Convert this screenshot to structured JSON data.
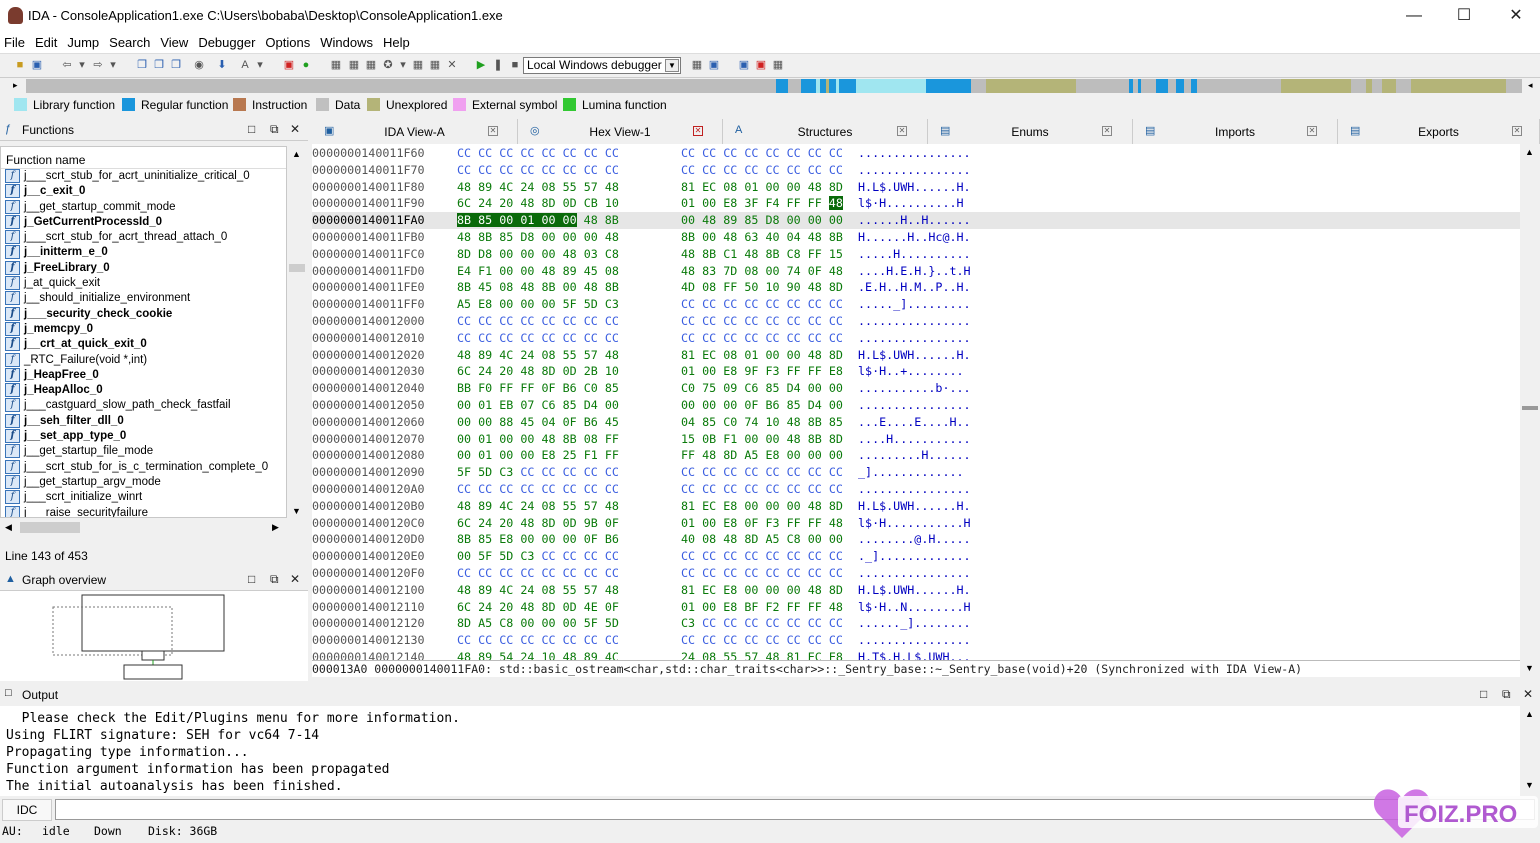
{
  "window": {
    "title": "IDA - ConsoleApplication1.exe C:\\Users\\bobaba\\Desktop\\ConsoleApplication1.exe"
  },
  "menu": [
    "File",
    "Edit",
    "Jump",
    "Search",
    "View",
    "Debugger",
    "Options",
    "Windows",
    "Help"
  ],
  "toolbar": {
    "debugger_select": "Local Windows debugger"
  },
  "legend": [
    {
      "label": "Library function",
      "color": "#a0e6f0"
    },
    {
      "label": "Regular function",
      "color": "#1a96dc"
    },
    {
      "label": "Instruction",
      "color": "#b87850"
    },
    {
      "label": "Data",
      "color": "#c0c0c0"
    },
    {
      "label": "Unexplored",
      "color": "#b4b478"
    },
    {
      "label": "External symbol",
      "color": "#f0a0f0"
    },
    {
      "label": "Lumina function",
      "color": "#32c832"
    }
  ],
  "functions_panel": {
    "title": "Functions",
    "column": "Function name",
    "line_status": "Line 143 of 453",
    "items": [
      {
        "name": "j___scrt_stub_for_acrt_uninitialize_critical_0",
        "bold": false
      },
      {
        "name": "j__c_exit_0",
        "bold": true
      },
      {
        "name": "j__get_startup_commit_mode",
        "bold": false
      },
      {
        "name": "j_GetCurrentProcessId_0",
        "bold": true
      },
      {
        "name": "j___scrt_stub_for_acrt_thread_attach_0",
        "bold": false
      },
      {
        "name": "j__initterm_e_0",
        "bold": true
      },
      {
        "name": "j_FreeLibrary_0",
        "bold": true
      },
      {
        "name": "j_at_quick_exit",
        "bold": false
      },
      {
        "name": "j__should_initialize_environment",
        "bold": false
      },
      {
        "name": "j___security_check_cookie",
        "bold": true
      },
      {
        "name": "j_memcpy_0",
        "bold": true
      },
      {
        "name": "j__crt_at_quick_exit_0",
        "bold": true
      },
      {
        "name": "_RTC_Failure(void *,int)",
        "bold": false
      },
      {
        "name": "j_HeapFree_0",
        "bold": true
      },
      {
        "name": "j_HeapAlloc_0",
        "bold": true
      },
      {
        "name": "j___castguard_slow_path_check_fastfail",
        "bold": false
      },
      {
        "name": "j__seh_filter_dll_0",
        "bold": true
      },
      {
        "name": "j__set_app_type_0",
        "bold": true
      },
      {
        "name": "j__get_startup_file_mode",
        "bold": false
      },
      {
        "name": "j___scrt_stub_for_is_c_termination_complete_0",
        "bold": false
      },
      {
        "name": "j__get_startup_argv_mode",
        "bold": false
      },
      {
        "name": "j___scrt_initialize_winrt",
        "bold": false
      },
      {
        "name": "j___raise_securityfailure",
        "bold": false
      }
    ]
  },
  "graph_panel": {
    "title": "Graph overview"
  },
  "tabs": [
    {
      "label": "IDA View-A",
      "active": false,
      "close_red": false
    },
    {
      "label": "Hex View-1",
      "active": true,
      "close_red": true
    },
    {
      "label": "Structures",
      "active": false,
      "close_red": false
    },
    {
      "label": "Enums",
      "active": false,
      "close_red": false
    },
    {
      "label": "Imports",
      "active": false,
      "close_red": false
    },
    {
      "label": "Exports",
      "active": false,
      "close_red": false
    }
  ],
  "hex_rows": [
    {
      "addr": "0000000140011F60",
      "b1": "CC CC CC CC CC CC CC CC",
      "b2": "CC CC CC CC CC CC CC CC",
      "ascii": "................"
    },
    {
      "addr": "0000000140011F70",
      "b1": "CC CC CC CC CC CC CC CC",
      "b2": "CC CC CC CC CC CC CC CC",
      "ascii": "................"
    },
    {
      "addr": "0000000140011F80",
      "b1": "48 89 4C 24 08 55 57 48",
      "b2": "81 EC 08 01 00 00 48 8D",
      "ascii": "H.L$.UWH......H."
    },
    {
      "addr": "0000000140011F90",
      "b1": "6C 24 20 48 8D 0D CB 10",
      "b2": "01 00 E8 3F F4 FF FF 48",
      "ascii": "l$·H..........H"
    },
    {
      "addr": "0000000140011FA0",
      "b1": "8B 85 00 01 00 00 48 8B",
      "b2": "00 48 89 85 D8 00 00 00",
      "ascii": "......H..H......"
    },
    {
      "addr": "0000000140011FB0",
      "b1": "48 8B 85 D8 00 00 00 48",
      "b2": "8B 00 48 63 40 04 48 8B",
      "ascii": "H......H..Hc@.H."
    },
    {
      "addr": "0000000140011FC0",
      "b1": "8D D8 00 00 00 48 03 C8",
      "b2": "48 8B C1 48 8B C8 FF 15",
      "ascii": ".....H.........."
    },
    {
      "addr": "0000000140011FD0",
      "b1": "E4 F1 00 00 48 89 45 08",
      "b2": "48 83 7D 08 00 74 0F 48",
      "ascii": "....H.E.H.}..t.H"
    },
    {
      "addr": "0000000140011FE0",
      "b1": "8B 45 08 48 8B 00 48 8B",
      "b2": "4D 08 FF 50 10 90 48 8D",
      "ascii": ".E.H..H.M..P..H."
    },
    {
      "addr": "0000000140011FF0",
      "b1": "A5 E8 00 00 00 5F 5D C3",
      "b2": "CC CC CC CC CC CC CC CC",
      "ascii": "....._]........."
    },
    {
      "addr": "0000000140012000",
      "b1": "CC CC CC CC CC CC CC CC",
      "b2": "CC CC CC CC CC CC CC CC",
      "ascii": "................"
    },
    {
      "addr": "0000000140012010",
      "b1": "CC CC CC CC CC CC CC CC",
      "b2": "CC CC CC CC CC CC CC CC",
      "ascii": "................"
    },
    {
      "addr": "0000000140012020",
      "b1": "48 89 4C 24 08 55 57 48",
      "b2": "81 EC 08 01 00 00 48 8D",
      "ascii": "H.L$.UWH......H."
    },
    {
      "addr": "0000000140012030",
      "b1": "6C 24 20 48 8D 0D 2B 10",
      "b2": "01 00 E8 9F F3 FF FF E8",
      "ascii": "l$·H..+........"
    },
    {
      "addr": "0000000140012040",
      "b1": "BB F0 FF FF 0F B6 C0 85",
      "b2": "C0 75 09 C6 85 D4 00 00",
      "ascii": "...........b·..."
    },
    {
      "addr": "0000000140012050",
      "b1": "00 01 EB 07 C6 85 D4 00",
      "b2": "00 00 00 0F B6 85 D4 00",
      "ascii": "................"
    },
    {
      "addr": "0000000140012060",
      "b1": "00 00 88 45 04 0F B6 45",
      "b2": "04 85 C0 74 10 48 8B 85",
      "ascii": "...E....E....H.."
    },
    {
      "addr": "0000000140012070",
      "b1": "00 01 00 00 48 8B 08 FF",
      "b2": "15 0B F1 00 00 48 8B 8D",
      "ascii": "....H..........."
    },
    {
      "addr": "0000000140012080",
      "b1": "00 01 00 00 E8 25 F1 FF",
      "b2": "FF 48 8D A5 E8 00 00 00",
      "ascii": ".........H......"
    },
    {
      "addr": "0000000140012090",
      "b1": "5F 5D C3 CC CC CC CC CC",
      "b2": "CC CC CC CC CC CC CC CC",
      "ascii": "_]............."
    },
    {
      "addr": "00000001400120A0",
      "b1": "CC CC CC CC CC CC CC CC",
      "b2": "CC CC CC CC CC CC CC CC",
      "ascii": "................"
    },
    {
      "addr": "00000001400120B0",
      "b1": "48 89 4C 24 08 55 57 48",
      "b2": "81 EC E8 00 00 00 48 8D",
      "ascii": "H.L$.UWH......H."
    },
    {
      "addr": "00000001400120C0",
      "b1": "6C 24 20 48 8D 0D 9B 0F",
      "b2": "01 00 E8 0F F3 FF FF 48",
      "ascii": "l$·H...........H"
    },
    {
      "addr": "00000001400120D0",
      "b1": "8B 85 E8 00 00 00 0F B6",
      "b2": "40 08 48 8D A5 C8 00 00",
      "ascii": "........@.H....."
    },
    {
      "addr": "00000001400120E0",
      "b1": "00 5F 5D C3 CC CC CC CC",
      "b2": "CC CC CC CC CC CC CC CC",
      "ascii": "._]............."
    },
    {
      "addr": "00000001400120F0",
      "b1": "CC CC CC CC CC CC CC CC",
      "b2": "CC CC CC CC CC CC CC CC",
      "ascii": "................"
    },
    {
      "addr": "0000000140012100",
      "b1": "48 89 4C 24 08 55 57 48",
      "b2": "81 EC E8 00 00 00 48 8D",
      "ascii": "H.L$.UWH......H."
    },
    {
      "addr": "0000000140012110",
      "b1": "6C 24 20 48 8D 0D 4E 0F",
      "b2": "01 00 E8 BF F2 FF FF 48",
      "ascii": "l$·H..N........H"
    },
    {
      "addr": "0000000140012120",
      "b1": "8D A5 C8 00 00 00 5F 5D",
      "b2": "C3 CC CC CC CC CC CC CC",
      "ascii": "......_]........"
    },
    {
      "addr": "0000000140012130",
      "b1": "CC CC CC CC CC CC CC CC",
      "b2": "CC CC CC CC CC CC CC CC",
      "ascii": "................"
    },
    {
      "addr": "0000000140012140",
      "b1": "48 89 54 24 10 48 89 4C",
      "b2": "24 08 55 57 48 81 EC E8",
      "ascii": "H.T$.H.L$.UWH..."
    }
  ],
  "hex_highlight": {
    "row": 4,
    "b1_hl": "8B 85 00 01 00 00",
    "b1_rest": " 48 8B",
    "row3_last": "48",
    "row3_prefix": "01 00 E8 3F F4 FF FF "
  },
  "hex_status": "000013A0|0000000140011FA0: std::basic_ostream<char,std::char_traits<char>>::_Sentry_base::~_Sentry_base(void)+20|(Synchronized with IDA View-A)",
  "output": {
    "title": "Output",
    "lines": [
      "  Please check the Edit/Plugins menu for more information.",
      "Using FLIRT signature: SEH for vc64 7-14",
      "Propagating type information...",
      "Function argument information has been propagated",
      "The initial autoanalysis has been finished."
    ]
  },
  "command": {
    "label": "IDC"
  },
  "status": {
    "au": "AU:",
    "state": "idle",
    "direction": "Down",
    "disk": "Disk: 36GB"
  },
  "watermark": {
    "text": "FOIZ.PRO"
  }
}
